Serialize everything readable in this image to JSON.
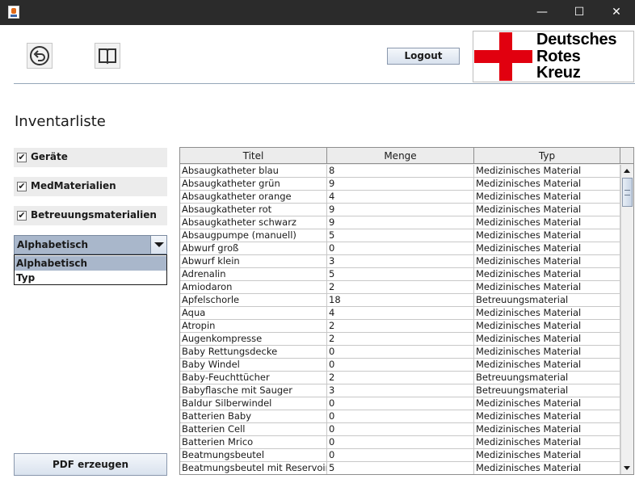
{
  "window": {
    "minimize": "—",
    "maximize": "☐",
    "close": "✕"
  },
  "toolbar": {
    "logout_label": "Logout"
  },
  "logo": {
    "line1": "Deutsches",
    "line2": "Rotes",
    "line3": "Kreuz",
    "cross_color": "#e1000f"
  },
  "page": {
    "heading": "Inventarliste"
  },
  "filters": [
    {
      "label": "Geräte",
      "checked": true
    },
    {
      "label": "MedMaterialien",
      "checked": true
    },
    {
      "label": "Betreuungsmaterialien",
      "checked": true
    }
  ],
  "sort": {
    "selected": "Alphabetisch",
    "options": [
      "Alphabetisch",
      "Typ"
    ]
  },
  "pdf_button": "PDF erzeugen",
  "table": {
    "columns": [
      "Titel",
      "Menge",
      "Typ"
    ],
    "rows": [
      [
        "Absaugkatheter blau",
        "8",
        "Medizinisches Material"
      ],
      [
        "Absaugkatheter grün",
        "9",
        "Medizinisches Material"
      ],
      [
        "Absaugkatheter orange",
        "4",
        "Medizinisches Material"
      ],
      [
        "Absaugkatheter rot",
        "9",
        "Medizinisches Material"
      ],
      [
        "Absaugkatheter schwarz",
        "9",
        "Medizinisches Material"
      ],
      [
        "Absaugpumpe (manuell)",
        "5",
        "Medizinisches Material"
      ],
      [
        "Abwurf groß",
        "0",
        "Medizinisches Material"
      ],
      [
        "Abwurf klein",
        "3",
        "Medizinisches Material"
      ],
      [
        "Adrenalin",
        "5",
        "Medizinisches Material"
      ],
      [
        "Amiodaron",
        "2",
        "Medizinisches Material"
      ],
      [
        "Apfelschorle",
        "18",
        "Betreuungsmaterial"
      ],
      [
        "Aqua",
        "4",
        "Medizinisches Material"
      ],
      [
        "Atropin",
        "2",
        "Medizinisches Material"
      ],
      [
        "Augenkompresse",
        "2",
        "Medizinisches Material"
      ],
      [
        "Baby Rettungsdecke",
        "0",
        "Medizinisches Material"
      ],
      [
        "Baby Windel",
        "0",
        "Medizinisches Material"
      ],
      [
        "Baby-Feuchttücher",
        "2",
        "Betreuungsmaterial"
      ],
      [
        "Babyflasche mit Sauger",
        "3",
        "Betreuungsmaterial"
      ],
      [
        "Baldur Silberwindel",
        "0",
        "Medizinisches Material"
      ],
      [
        "Batterien Baby",
        "0",
        "Medizinisches Material"
      ],
      [
        "Batterien Cell",
        "0",
        "Medizinisches Material"
      ],
      [
        "Batterien Mrico",
        "0",
        "Medizinisches Material"
      ],
      [
        "Beatmungsbeutel",
        "0",
        "Medizinisches Material"
      ],
      [
        "Beatmungsbeutel mit Reservoir",
        "5",
        "Medizinisches Material"
      ]
    ]
  }
}
